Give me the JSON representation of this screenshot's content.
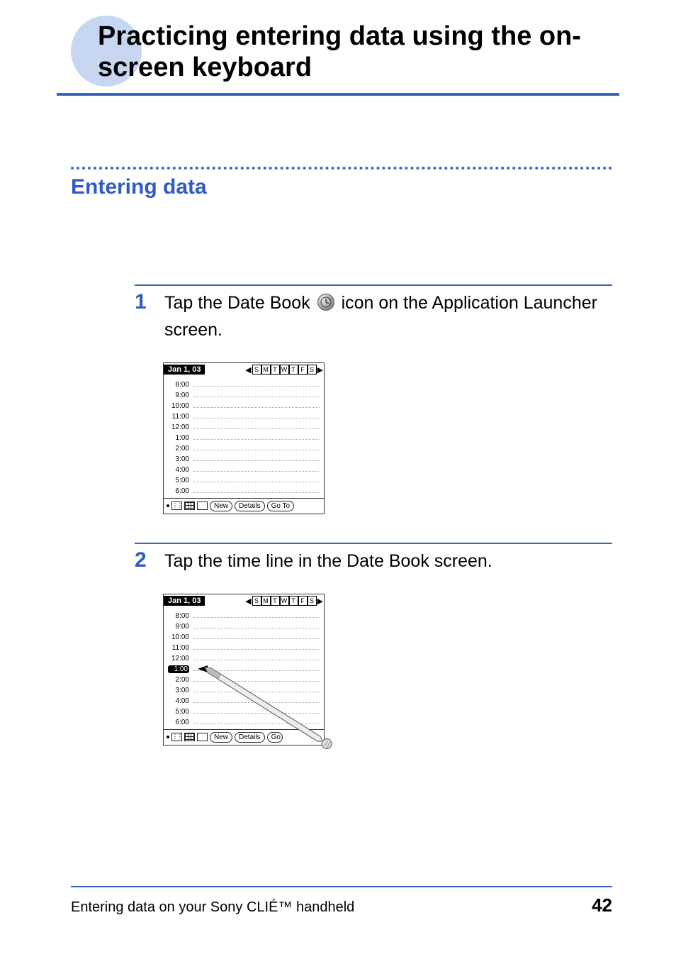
{
  "title": "Practicing entering data using the on-screen keyboard",
  "subtitle": "Entering data",
  "steps": {
    "s1": {
      "num": "1",
      "text_a": "Tap the Date Book ",
      "text_b": " icon on the Application Launcher screen."
    },
    "s2": {
      "num": "2",
      "text": "Tap the time line in the Date Book screen."
    }
  },
  "datebook": {
    "title": "Jan 1, 03",
    "days": [
      "S",
      "M",
      "T",
      "W",
      "T",
      "F",
      "S"
    ],
    "times": [
      "8:00",
      "9:00",
      "10:00",
      "11:00",
      "12:00",
      "1:00",
      "2:00",
      "3:00",
      "4:00",
      "5:00",
      "6:00"
    ],
    "selected_time": "1:00",
    "buttons": {
      "new": "New",
      "details": "Details",
      "goto": "Go To",
      "goto_cut": "Go"
    }
  },
  "footer": {
    "text": "Entering data on your Sony CLIÉ™ handheld",
    "page": "42"
  }
}
